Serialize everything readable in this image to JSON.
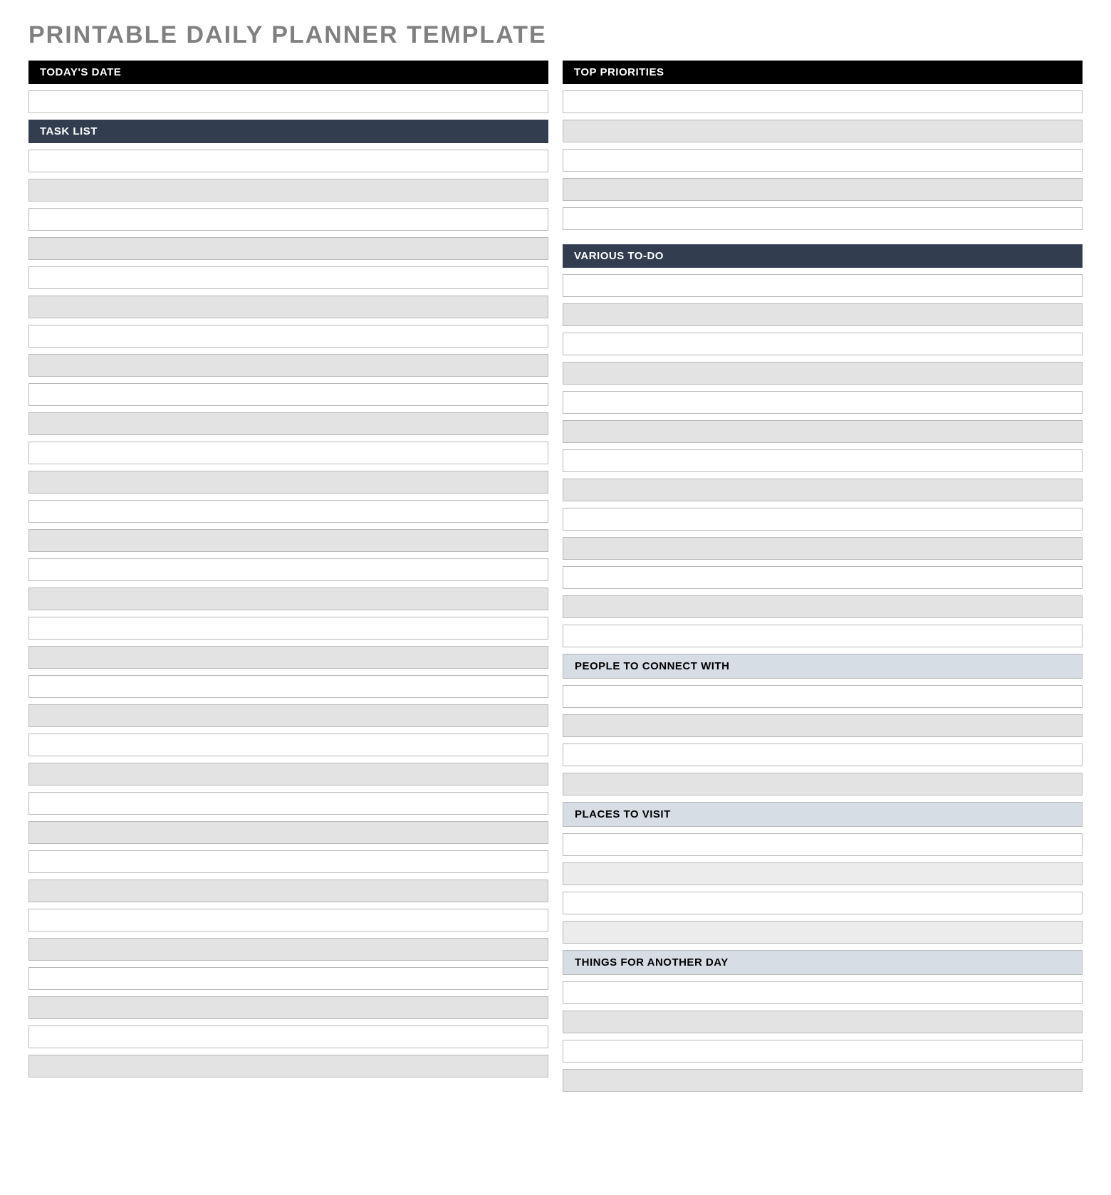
{
  "title": "PRINTABLE DAILY PLANNER TEMPLATE",
  "left": {
    "todays_date": {
      "label": "TODAY'S DATE",
      "rows": [
        ""
      ]
    },
    "task_list": {
      "label": "TASK LIST",
      "rows": [
        "",
        "",
        "",
        "",
        "",
        "",
        "",
        "",
        "",
        "",
        "",
        "",
        "",
        "",
        "",
        "",
        "",
        "",
        "",
        "",
        "",
        "",
        "",
        "",
        "",
        "",
        "",
        "",
        "",
        "",
        "",
        ""
      ]
    }
  },
  "right": {
    "top_priorities": {
      "label": "TOP PRIORITIES",
      "rows": [
        "",
        "",
        "",
        "",
        "",
        ""
      ]
    },
    "various_todo": {
      "label": "VARIOUS TO-DO",
      "rows": [
        "",
        "",
        "",
        "",
        "",
        "",
        "",
        "",
        "",
        "",
        "",
        "",
        ""
      ]
    },
    "people_connect": {
      "label": "PEOPLE TO CONNECT WITH",
      "rows": [
        "",
        "",
        "",
        ""
      ]
    },
    "places_visit": {
      "label": "PLACES TO VISIT",
      "rows": [
        "",
        "",
        "",
        ""
      ]
    },
    "things_another_day": {
      "label": "THINGS FOR ANOTHER DAY",
      "rows": [
        "",
        "",
        "",
        ""
      ]
    }
  }
}
